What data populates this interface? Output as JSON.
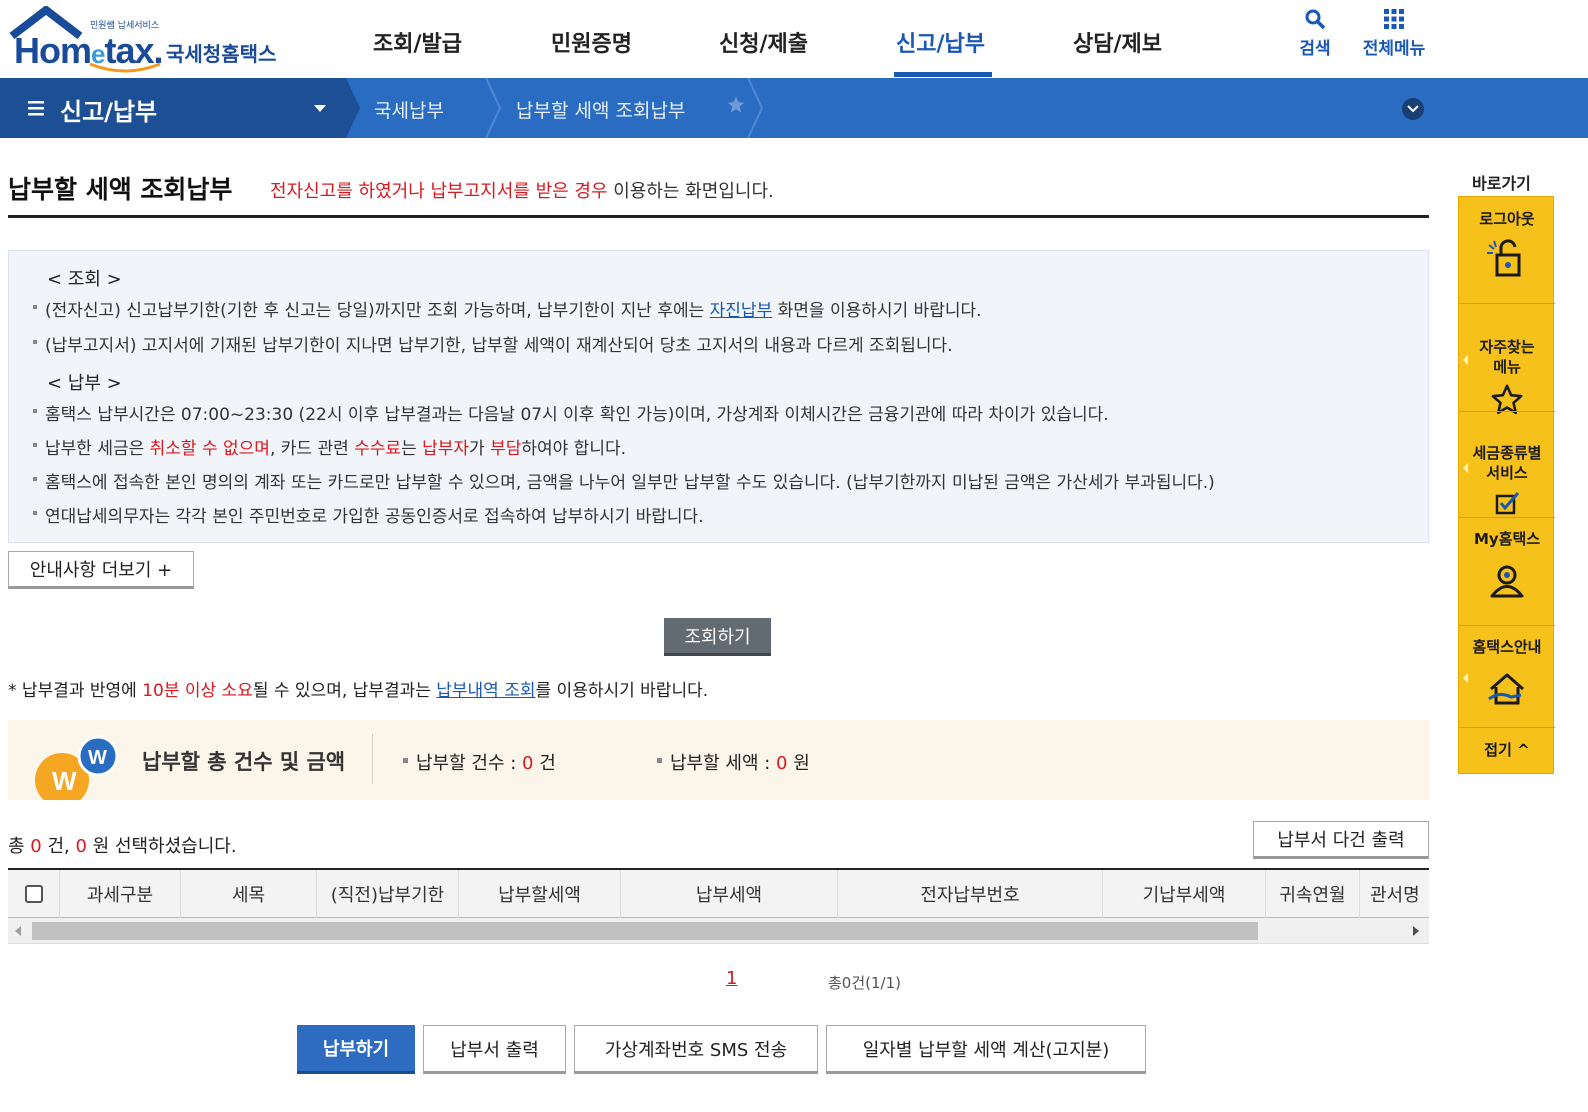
{
  "header": {
    "logo_small": "민원쌤 납세서비스",
    "logo_home": "Hom",
    "logo_e": "e",
    "logo_tax": "tax.",
    "logo_kr": "국세청홈택스",
    "nav": [
      "조회/발급",
      "민원증명",
      "신청/제출",
      "신고/납부",
      "상담/제보"
    ],
    "active_nav": "신고/납부",
    "search_label": "검색",
    "menu_label": "전체메뉴"
  },
  "breadcrumb": {
    "section": "신고/납부",
    "level1": "국세납부",
    "level2": "납부할 세액 조회납부"
  },
  "page": {
    "title": "납부할 세액 조회납부",
    "subtitle_red": "전자신고를 하였거나 납부고지서를 받은 경우",
    "subtitle_rest": " 이용하는 화면입니다."
  },
  "notice": {
    "head1": "< 조회 >",
    "l1_a": "(전자신고) 신고납부기한(기한 후 신고는 당일)까지만 조회 가능하며, 납부기한이 지난 후에는 ",
    "l1_link": "자진납부",
    "l1_b": " 화면을 이용하시기 바랍니다.",
    "l2": "(납부고지서) 고지서에 기재된 납부기한이 지나면 납부기한, 납부할 세액이 재계산되어 당초 고지서의 내용과 다르게 조회됩니다.",
    "head2": "< 납부 >",
    "l3": "홈택스 납부시간은 07:00~23:30 (22시 이후 납부결과는 다음날 07시 이후 확인 가능)이며, 가상계좌 이체시간은 금융기관에 따라 차이가 있습니다.",
    "l4_a": "납부한 세금은 ",
    "l4_r1": "취소할 수 없으며",
    "l4_b": ", 카드 관련 ",
    "l4_r2": "수수료",
    "l4_c": "는 ",
    "l4_r3": "납부자",
    "l4_d": "가 ",
    "l4_r4": "부담",
    "l4_e": "하여야 합니다.",
    "l5": "홈택스에 접속한 본인 명의의 계좌 또는 카드로만 납부할 수 있으며, 금액을 나누어 일부만 납부할 수도 있습니다. (납부기한까지 미납된 금액은 가산세가 부과됩니다.)",
    "l6": "연대납세의무자는 각각 본인 주민번호로 가입한 공동인증서로 접속하여 납부하시기 바랍니다."
  },
  "buttons": {
    "more": "안내사항 더보기 +",
    "search": "조회하기",
    "multi_print": "납부서 다건 출력",
    "pay": "납부하기",
    "print": "납부서 출력",
    "sms": "가상계좌번호 SMS 전송",
    "daily": "일자별 납부할 세액 계산(고지분)"
  },
  "note": {
    "a": "* 납부결과 반영에 ",
    "red": "10분 이상 소요",
    "b": "될 수 있으며, 납부결과는 ",
    "link": "납부내역 조회",
    "c": "를 이용하시기 바랍니다."
  },
  "summary": {
    "title": "납부할 총 건수 및 금액",
    "count_label": "납부할 건수 : ",
    "count_value": "0",
    "count_unit": " 건",
    "amount_label": "납부할 세액 : ",
    "amount_value": "0",
    "amount_unit": " 원"
  },
  "selected": {
    "a": "총 ",
    "count": "0",
    "b": " 건, ",
    "amount": "0",
    "c": " 원 선택하셨습니다."
  },
  "table": {
    "columns": [
      "과세구분",
      "세목",
      "(직전)납부기한",
      "납부할세액",
      "납부세액",
      "전자납부번호",
      "기납부세액",
      "귀속연월",
      "관서명"
    ]
  },
  "pager": {
    "current": "1",
    "total": "총0건(1/1)"
  },
  "quick": {
    "title": "바로가기",
    "items": [
      "로그아웃",
      "자주찾는\n메뉴",
      "세금종류별\n서비스",
      "My홈택스",
      "홈택스안내"
    ],
    "fold": "접기 ^"
  },
  "colors": {
    "brand_blue": "#2a6cc1",
    "dark_blue": "#1d4f94",
    "accent_red": "#d8191f",
    "quick_yellow": "#f7c11b"
  }
}
